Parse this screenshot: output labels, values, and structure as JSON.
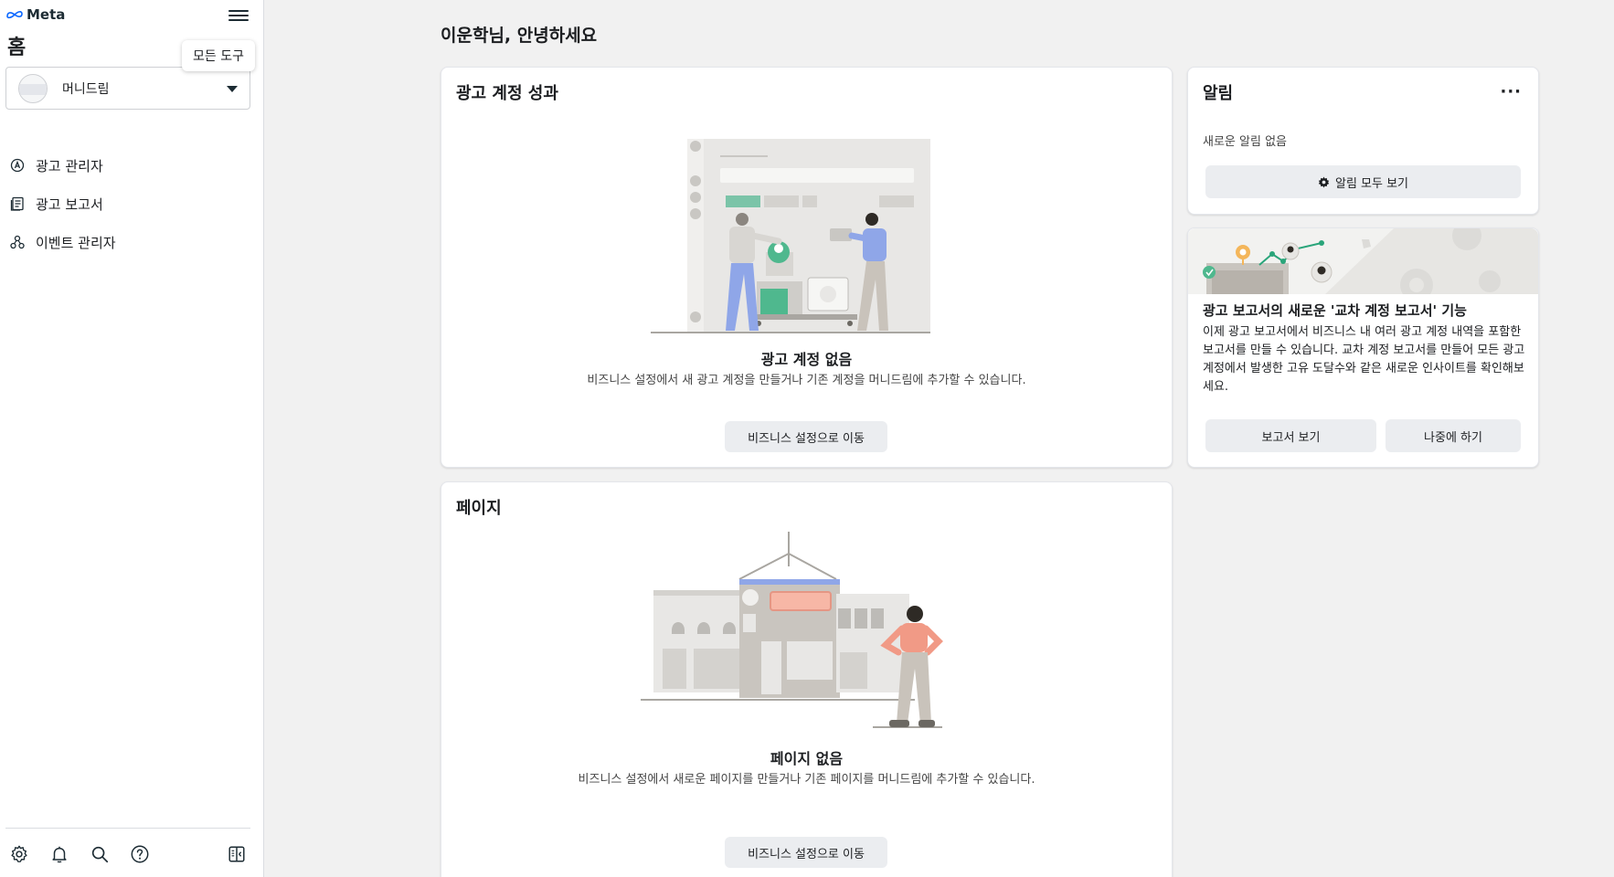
{
  "app": {
    "brand": "Meta"
  },
  "sidebar": {
    "page_title": "홈",
    "tooltip": "모든 도구",
    "account_name": "머니드림",
    "items": [
      {
        "label": "광고 관리자",
        "icon": "ads-manager-icon"
      },
      {
        "label": "광고 보고서",
        "icon": "ads-reporting-icon"
      },
      {
        "label": "이벤트 관리자",
        "icon": "events-manager-icon"
      }
    ],
    "bottom_icons": [
      "settings-icon",
      "notifications-icon",
      "search-icon",
      "help-icon",
      "collapse-panel-icon"
    ]
  },
  "main": {
    "greeting": "이운학님, 안녕하세요",
    "ad_account_card": {
      "title": "광고 계정 성과",
      "empty_title": "광고 계정 없음",
      "empty_desc": "비즈니스 설정에서 새 광고 계정을 만들거나 기존 계정을 머니드림에 추가할 수 있습니다.",
      "button": "비즈니스 설정으로 이동"
    },
    "pages_card": {
      "title": "페이지",
      "empty_title": "페이지 없음",
      "empty_desc": "비즈니스 설정에서 새로운 페이지를 만들거나 기존 페이지를 머니드림에 추가할 수 있습니다.",
      "button": "비즈니스 설정으로 이동"
    },
    "notifications_card": {
      "title": "알림",
      "more": "···",
      "empty_text": "새로운 알림 없음",
      "button": "알림 모두 보기"
    },
    "promo_card": {
      "title": "광고 보고서의 새로운 '교차 계정 보고서' 기능",
      "body": "이제 광고 보고서에서 비즈니스 내 여러 광고 계정 내역을 포함한 보고서를 만들 수 있습니다. 교차 계정 보고서를 만들어 모든 광고 계정에서 발생한 고유 도달수와 같은 새로운 인사이트를 확인해보세요.",
      "primary_button": "보고서 보기",
      "secondary_button": "나중에 하기"
    }
  },
  "colors": {
    "accent_blue": "#0866ff",
    "button_bg": "#ebedf0",
    "page_bg": "#f1f1f1"
  }
}
